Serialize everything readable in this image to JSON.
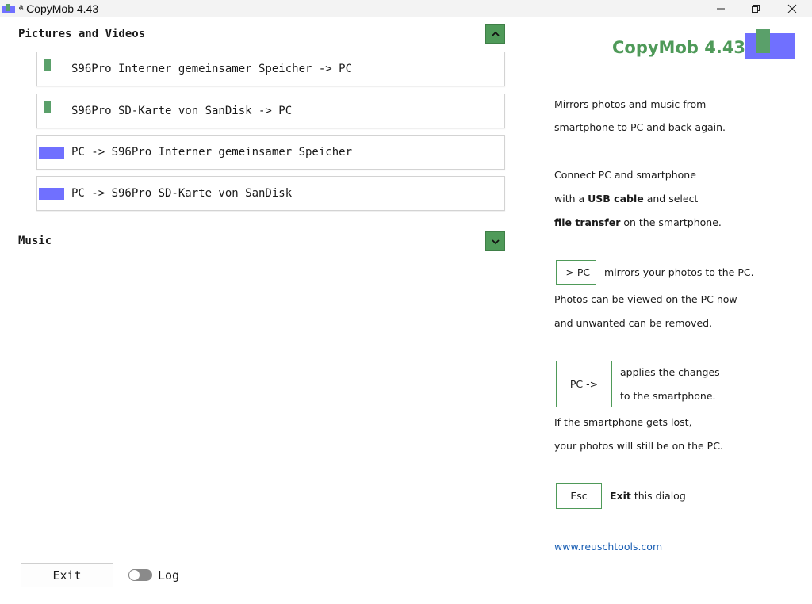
{
  "window": {
    "title": "ª CopyMob 4.43"
  },
  "sections": {
    "pictures": {
      "title": "Pictures and Videos",
      "items": [
        {
          "label": "S96Pro Interner gemeinsamer Speicher -> PC"
        },
        {
          "label": "S96Pro SD-Karte von SanDisk -> PC"
        },
        {
          "label": "PC -> S96Pro Interner gemeinsamer Speicher"
        },
        {
          "label": "PC -> S96Pro SD-Karte von SanDisk"
        }
      ]
    },
    "music": {
      "title": "Music"
    }
  },
  "help": {
    "brand": "CopyMob 4.43",
    "intro1": "Mirrors photos and music from",
    "intro2": "smartphone to PC and back again.",
    "connect1": "Connect PC and smartphone",
    "connect2_pre": "with a ",
    "connect2_bold": "USB cable",
    "connect2_post": " and select",
    "connect3_bold": "file transfer",
    "connect3_post": " on the smartphone.",
    "topc_key": "-> PC",
    "topc_desc": "mirrors your photos to the PC.",
    "topc_line2": "Photos can be viewed on the PC now",
    "topc_line3": "and unwanted can be removed.",
    "fromPc_key": "PC ->",
    "fromPc_desc1": "applies the changes",
    "fromPc_desc2": "to the smartphone.",
    "lost1": "If the smartphone gets lost,",
    "lost2": "your photos will still be on the PC.",
    "esc_key": "Esc",
    "esc_bold": "Exit",
    "esc_post": " this dialog",
    "website": "www.reuschtools.com"
  },
  "footer": {
    "exit_label": "Exit",
    "log_label": "Log",
    "log_enabled": false
  },
  "colors": {
    "accent_green": "#4f9a59",
    "accent_blue": "#7070ff",
    "link": "#1a5fb4"
  }
}
